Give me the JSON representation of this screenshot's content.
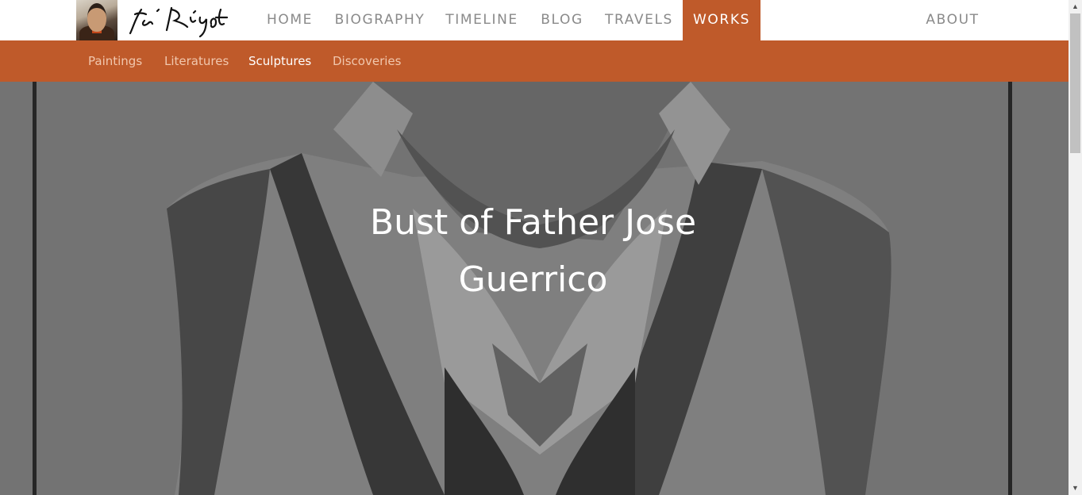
{
  "nav": {
    "items": [
      {
        "label": "HOME"
      },
      {
        "label": "BIOGRAPHY"
      },
      {
        "label": "TIMELINE"
      },
      {
        "label": "BLOG"
      },
      {
        "label": "TRAVELS"
      },
      {
        "label": "WORKS"
      },
      {
        "label": "ABOUT"
      }
    ],
    "active": "WORKS"
  },
  "subnav": {
    "items": [
      {
        "label": "Paintings"
      },
      {
        "label": "Literatures"
      },
      {
        "label": "Sculptures"
      },
      {
        "label": "Discoveries"
      }
    ],
    "active": "Sculptures"
  },
  "hero": {
    "title_line1": "Bust of Father Jose",
    "title_line2": "Guerrico"
  },
  "colors": {
    "accent": "#bf5a2a",
    "nav_text": "#8a8a8a",
    "subnav_text": "#f1c7ad",
    "hero_overlay": "#7a7a7a"
  },
  "icons": {
    "scroll_up": "scroll-up-arrow-icon",
    "scroll_down": "scroll-down-arrow-icon"
  }
}
